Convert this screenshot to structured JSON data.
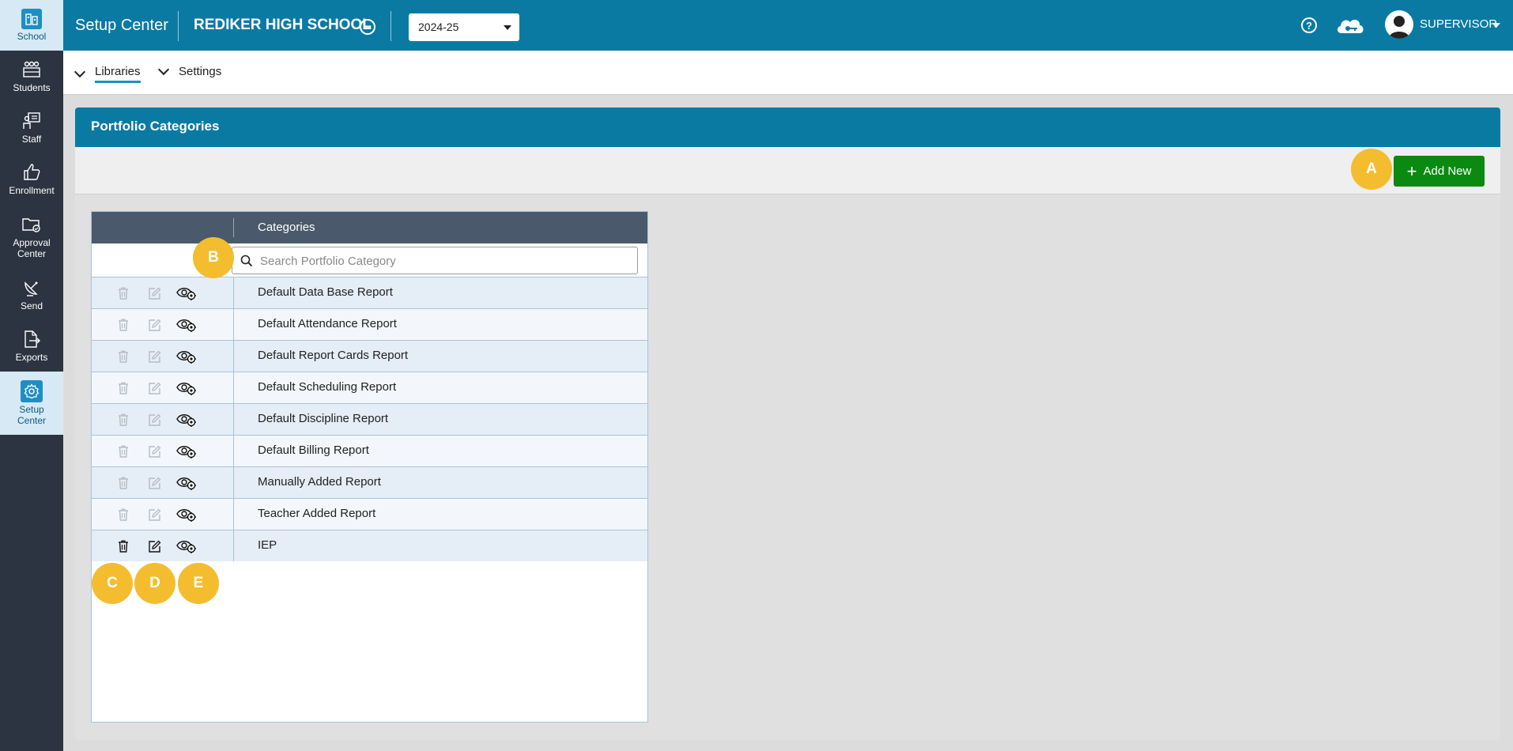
{
  "nav": {
    "items": [
      {
        "label": "School",
        "icon": "school-icon"
      },
      {
        "label": "Students",
        "icon": "students-icon"
      },
      {
        "label": "Staff",
        "icon": "staff-icon"
      },
      {
        "label": "Enrollment",
        "icon": "thumbs-up-icon"
      },
      {
        "label": "Approval\nCenter",
        "icon": "folder-check-icon"
      },
      {
        "label": "Send",
        "icon": "satellite-dish-icon"
      },
      {
        "label": "Exports",
        "icon": "export-file-icon"
      },
      {
        "label": "Setup\nCenter",
        "icon": "gear-icon"
      }
    ]
  },
  "header": {
    "app_title": "Setup Center",
    "school_name": "REDIKER HIGH SCHOOL",
    "year": "2024-25",
    "user": "SUPERVISOR"
  },
  "subnav": {
    "libraries": "Libraries",
    "settings": "Settings"
  },
  "panel": {
    "title": "Portfolio Categories",
    "add_button": "Add New"
  },
  "table": {
    "column_header": "Categories",
    "search_placeholder": "Search Portfolio Category",
    "rows": [
      {
        "name": "Default Data Base Report",
        "enabled": false
      },
      {
        "name": "Default Attendance Report",
        "enabled": false
      },
      {
        "name": "Default Report Cards Report",
        "enabled": false
      },
      {
        "name": "Default Scheduling Report",
        "enabled": false
      },
      {
        "name": "Default Discipline Report",
        "enabled": false
      },
      {
        "name": "Default Billing Report",
        "enabled": false
      },
      {
        "name": "Manually Added Report",
        "enabled": false
      },
      {
        "name": "Teacher Added Report",
        "enabled": false
      },
      {
        "name": "IEP",
        "enabled": true
      }
    ]
  },
  "callouts": {
    "a": "A",
    "b": "B",
    "c": "C",
    "d": "D",
    "e": "E"
  },
  "colors": {
    "accent": "#0a7aa3",
    "add_button": "#0b8a12",
    "callout": "#f3bd2f",
    "nav_bg": "#2b3440"
  }
}
